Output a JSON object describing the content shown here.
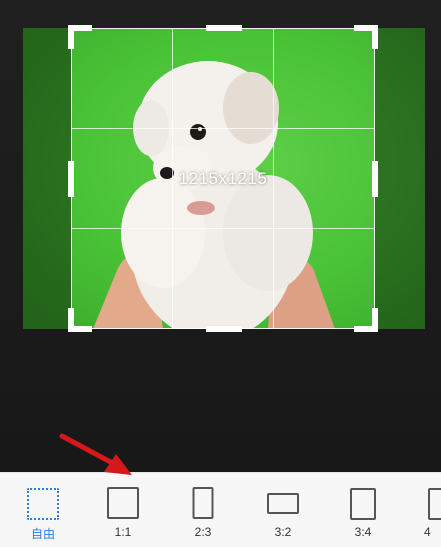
{
  "crop": {
    "size_label": "1215x1215"
  },
  "aspect_ratios": [
    {
      "label": "自由",
      "selected": true
    },
    {
      "label": "1:1",
      "selected": false
    },
    {
      "label": "2:3",
      "selected": false
    },
    {
      "label": "3:2",
      "selected": false
    },
    {
      "label": "3:4",
      "selected": false
    },
    {
      "label": "4",
      "selected": false
    }
  ],
  "colors": {
    "accent": "#2c7be5",
    "arrow": "#d4191b",
    "backdrop": "#49c236"
  }
}
